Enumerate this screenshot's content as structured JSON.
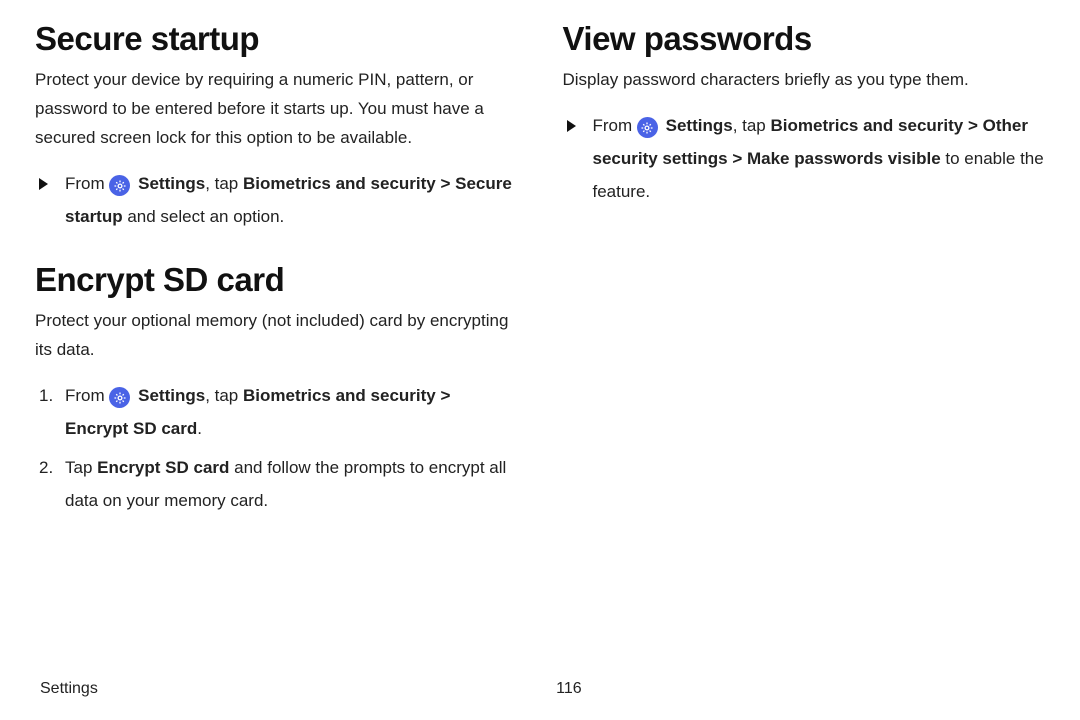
{
  "left": {
    "s1": {
      "title": "Secure startup",
      "desc": "Protect your device by requiring a numeric PIN, pattern, or password to be entered before it starts up. You must have a secured screen lock for this option to be available.",
      "step": {
        "pre": "From ",
        "settings": "Settings",
        "mid1": ", tap ",
        "b1": "Biometrics and security",
        "gt1": " > ",
        "b2": "Secure startup",
        "post": " and select an option."
      }
    },
    "s2": {
      "title": "Encrypt SD card",
      "desc": "Protect your optional memory (not included) card by encrypting its data.",
      "step1": {
        "num": "1.",
        "pre": "From ",
        "settings": "Settings",
        "mid1": ", tap ",
        "b1": "Biometrics and security",
        "gt1": " > ",
        "b2": "Encrypt SD card",
        "post": "."
      },
      "step2": {
        "num": "2.",
        "pre": "Tap ",
        "b1": "Encrypt SD card",
        "post": " and follow the prompts to encrypt all data on your memory card."
      }
    }
  },
  "right": {
    "s1": {
      "title": "View passwords",
      "desc": "Display password characters briefly as you type them.",
      "step": {
        "pre": "From ",
        "settings": "Settings",
        "mid1": ", tap ",
        "b1": "Biometrics and security",
        "gt1": " > ",
        "b2": "Other security settings",
        "gt2": " > ",
        "b3": "Make passwords visible",
        "post": " to enable the feature."
      }
    }
  },
  "footer": {
    "section": "Settings",
    "page": "116"
  }
}
